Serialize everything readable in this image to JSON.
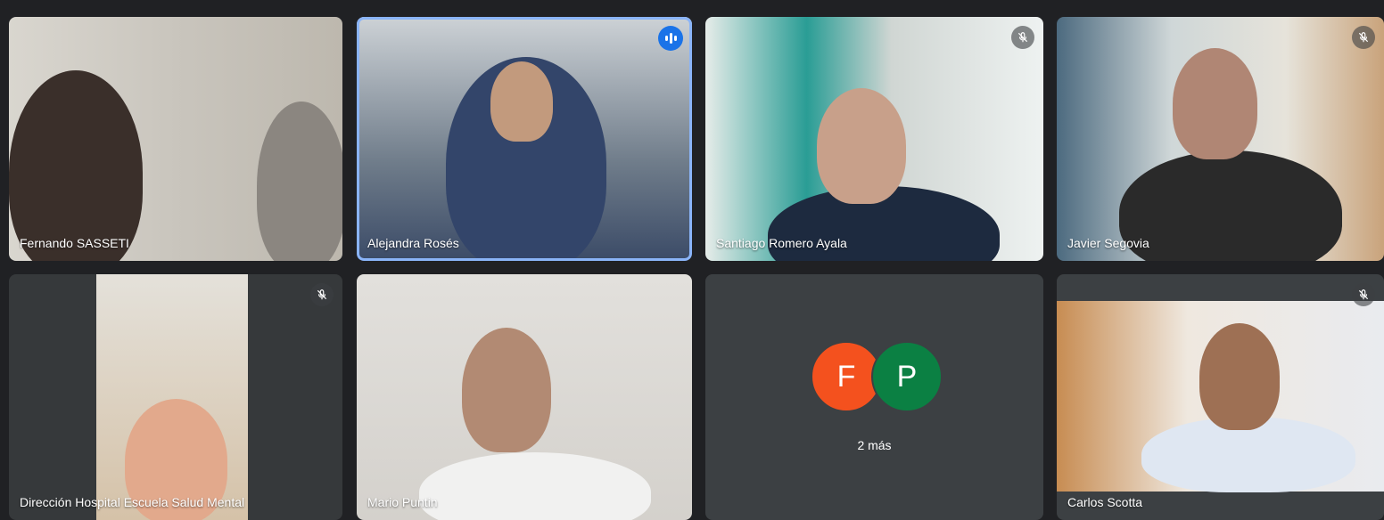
{
  "participants": [
    {
      "name": "Fernando SASSETI",
      "muted": false
    },
    {
      "name": "Alejandra Rosés",
      "muted": false,
      "speaking": true
    },
    {
      "name": "Santiago Romero Ayala",
      "muted": true
    },
    {
      "name": "Javier Segovia",
      "muted": true
    },
    {
      "name": "Dirección Hospital Escuela Salud Mental",
      "muted": true
    },
    {
      "name": "Mario Puntin",
      "muted": false
    },
    {
      "name": "Carlos Scotta",
      "muted": true
    }
  ],
  "overflow_tile": {
    "avatars": [
      {
        "letter": "F",
        "color": "#f4511e"
      },
      {
        "letter": "P",
        "color": "#0b8043"
      }
    ],
    "more_label": "2 más"
  },
  "colors": {
    "background": "#202124",
    "tile": "#3c4043",
    "active_border": "#8ab4f8",
    "speaking_badge": "#1a73e8"
  },
  "icons": {
    "mute": "mic-off-icon",
    "speaking": "audio-level-icon"
  }
}
